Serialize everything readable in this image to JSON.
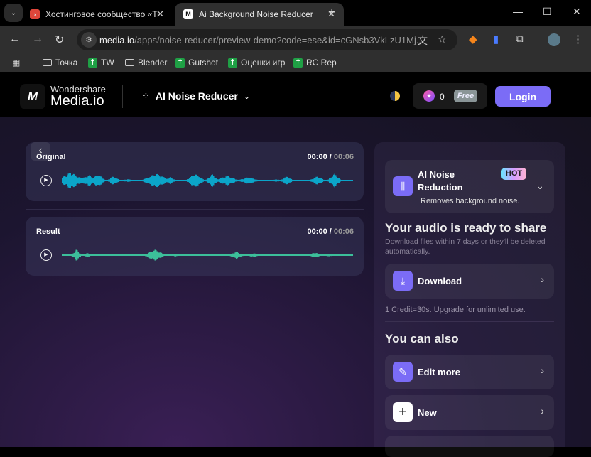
{
  "browser": {
    "tabs": [
      {
        "title": "Хостинговое сообщество «Tim",
        "favicon_color": "#e0463a"
      },
      {
        "title": "Ai Background Noise Reducer f",
        "favicon_color": "#111111"
      }
    ],
    "url_host": "media.io",
    "url_path": "/apps/noise-reducer/preview-demo?code=ese&id=cGNsb3VkLzU1Mj...",
    "bookmarks": [
      {
        "label": "Точка",
        "icon": "folder-icon"
      },
      {
        "label": "TW",
        "icon": "green-bookmark-icon"
      },
      {
        "label": "Blender",
        "icon": "folder-icon"
      },
      {
        "label": "Gutshot",
        "icon": "green-bookmark-icon"
      },
      {
        "label": "Оценки игр",
        "icon": "green-bookmark-icon"
      },
      {
        "label": "RC Rep",
        "icon": "green-bookmark-icon"
      }
    ]
  },
  "header": {
    "brand_top": "Wondershare",
    "brand_bottom": "Media.io",
    "logo_text": "M",
    "product": "AI Noise Reducer",
    "credits": "0",
    "plan": "Free",
    "login": "Login"
  },
  "players": [
    {
      "label": "Original",
      "current": "00:00",
      "duration": "00:06",
      "color": "#0ba5c9"
    },
    {
      "label": "Result",
      "current": "00:00",
      "duration": "00:06",
      "color": "#3cbf9a"
    }
  ],
  "panel": {
    "feature_title_1": "AI Noise",
    "feature_title_2": "Reduction",
    "badge": "HOT",
    "feature_desc": "Removes background noise.",
    "ready_title": "Your audio is ready to share",
    "ready_desc": "Download files within 7 days or they'll be deleted automatically.",
    "download": "Download",
    "credit_note": "1 Credit=30s. Upgrade for unlimited use.",
    "also_title": "You can also",
    "edit_more": "Edit more",
    "new": "New"
  },
  "colors": {
    "accent": "#7b6cf6"
  }
}
